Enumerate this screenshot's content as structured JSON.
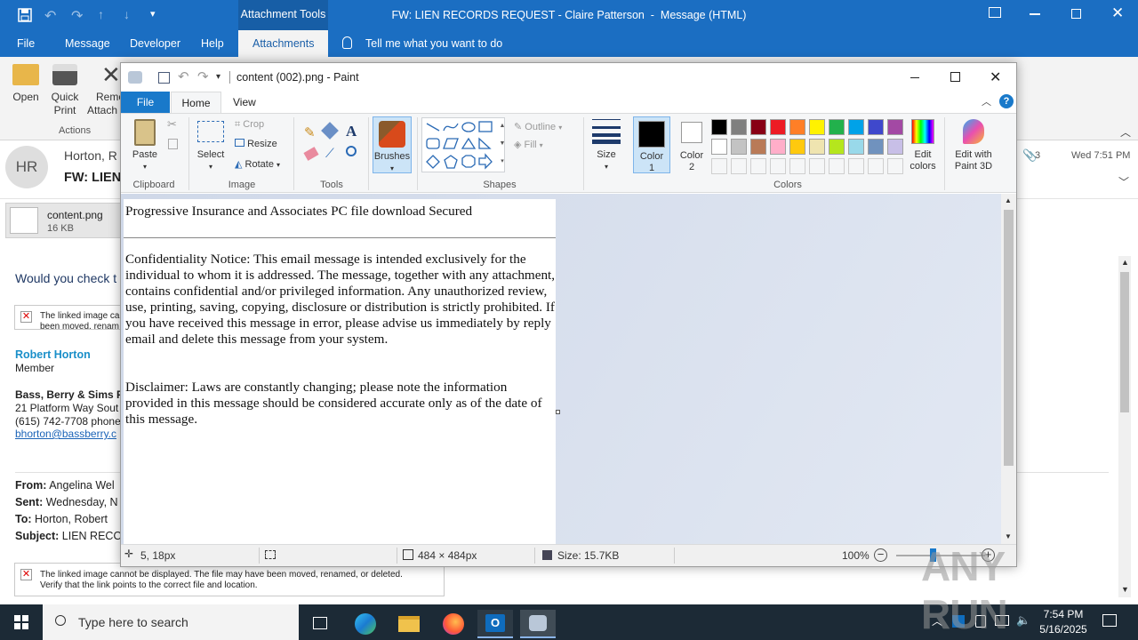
{
  "outlook": {
    "title": "FW: LIEN RECORDS REQUEST - Claire Patterson  -  Message (HTML)",
    "context_tab": "Attachment Tools",
    "tabs": [
      "File",
      "Message",
      "Developer",
      "Help",
      "Attachments"
    ],
    "tell_me": "Tell me what you want to do",
    "ribbon": {
      "open": "Open",
      "quick_print_1": "Quick",
      "quick_print_2": "Print",
      "remove_1": "Remo",
      "remove_2": "Attach",
      "group_actions": "Actions"
    },
    "sender_initials": "HR",
    "sender_name": "Horton, R",
    "subject": "FW: LIEN",
    "attachment_count": "3",
    "received": "Wed 7:51 PM",
    "attachment": {
      "name": "content.png",
      "size": "16 KB"
    },
    "body": {
      "greeting": "Would you check t",
      "broken1_a": "The linked image ca",
      "broken1_b": "been moved, renam",
      "sig_name": "Robert Horton",
      "sig_title": "Member",
      "sig_firm": "Bass, Berry & Sims P",
      "sig_addr": "21 Platform Way Sout",
      "sig_phone": "(615) 742-7708 phone",
      "sig_email": "bhorton@bassberry.c",
      "from_label": "From:",
      "from_val": "Angelina Wel",
      "sent_label": "Sent:",
      "sent_val": "Wednesday, N",
      "to_label": "To:",
      "to_val": "Horton, Robert",
      "subject_label": "Subject:",
      "subject_val": "LIEN RECO",
      "broken2_a": "The linked image cannot be displayed.  The file may have been moved, renamed, or deleted.",
      "broken2_b": "Verify that the link points to the correct file and location."
    }
  },
  "paint": {
    "title": "content (002).png - Paint",
    "tabs": [
      "File",
      "Home",
      "View"
    ],
    "clipboard": {
      "paste": "Paste",
      "label": "Clipboard"
    },
    "image": {
      "select": "Select",
      "crop": "Crop",
      "resize": "Resize",
      "rotate": "Rotate",
      "label": "Image"
    },
    "tools_label": "Tools",
    "brushes": "Brushes",
    "shapes": {
      "outline": "Outline",
      "fill": "Fill",
      "label": "Shapes"
    },
    "size": "Size",
    "color1": "Color 1",
    "color2": "Color 2",
    "colors_label": "Colors",
    "edit_colors_1": "Edit",
    "edit_colors_2": "colors",
    "paint3d_1": "Edit with",
    "paint3d_2": "Paint 3D",
    "palette_row1": [
      "#000000",
      "#7f7f7f",
      "#880015",
      "#ed1c24",
      "#ff7f27",
      "#fff200",
      "#22b14c",
      "#00a2e8",
      "#3f48cc",
      "#a349a4"
    ],
    "palette_row2": [
      "#ffffff",
      "#c3c3c3",
      "#b97a57",
      "#ffaec9",
      "#ffc90e",
      "#efe4b0",
      "#b5e61d",
      "#99d9ea",
      "#7092be",
      "#c8bfe7"
    ],
    "canvas": {
      "heading": "Progressive Insurance and Associates PC file download Secured",
      "notice": "Confidentiality Notice: This email message is intended exclusively for the individual to whom it is addressed. The message, together with any attachment, contains confidential and/or privileged information. Any unauthorized review, use, printing, saving, copying, disclosure or distribution is strictly prohibited. If you have received this message in error, please advise us immediately by reply email and delete this message from your system.",
      "disclaimer": "Disclaimer: Laws are constantly changing; please note the information provided in this message should be considered accurate only as of the date of this message."
    },
    "status": {
      "cursor": "5, 18px",
      "dimensions": "484 × 484px",
      "size": "Size: 15.7KB",
      "zoom": "100%"
    }
  },
  "taskbar": {
    "search_placeholder": "Type here to search",
    "time": "7:54 PM",
    "date": "5/16/2025"
  },
  "watermark": "ANY RUN"
}
